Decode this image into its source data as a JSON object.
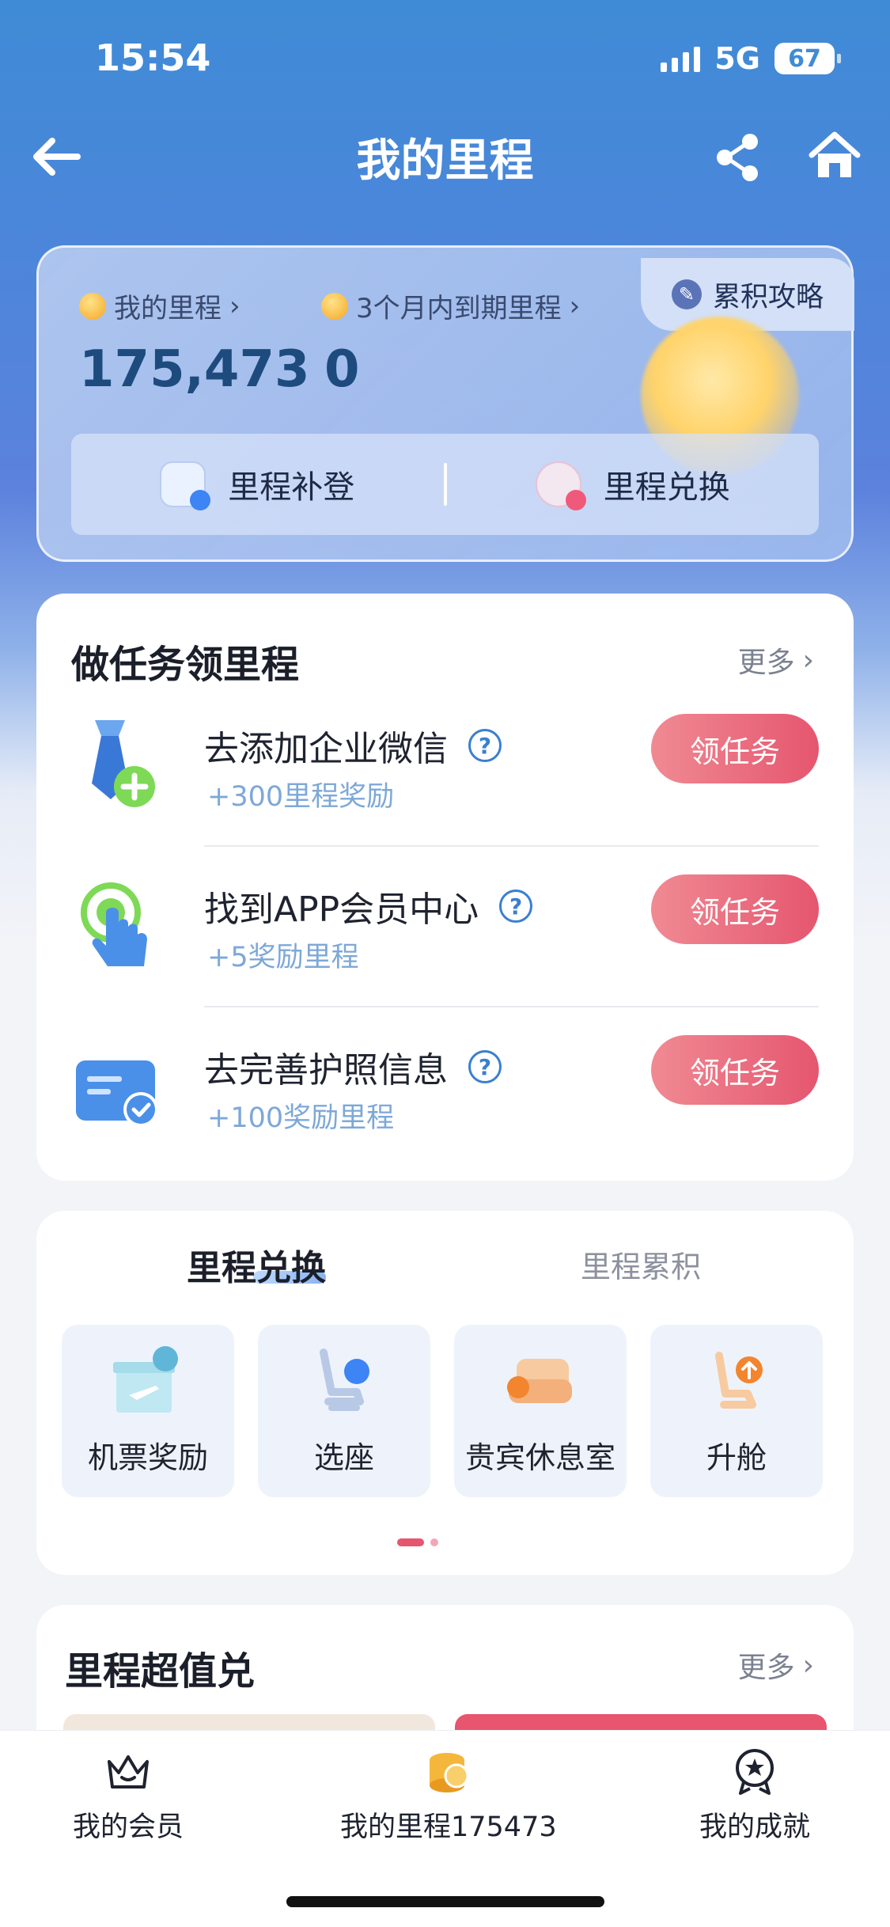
{
  "status": {
    "time": "15:54",
    "network": "5G",
    "battery": "67"
  },
  "nav": {
    "title": "我的里程",
    "back_icon": "back-arrow-icon",
    "share_icon": "share-icon",
    "home_icon": "home-icon"
  },
  "miles_card": {
    "guide_label": "累积攻略",
    "my_miles_label": "我的里程",
    "my_miles_value": "175,473",
    "expiring_label": "3个月内到期里程",
    "expiring_value": "0",
    "action_claim": "里程补登",
    "action_exchange": "里程兑换"
  },
  "tasks": {
    "title": "做任务领里程",
    "more": "更多",
    "items": [
      {
        "name": "去添加企业微信",
        "reward": "+300里程奖励",
        "button": "领任务",
        "icon": "wecom-add-icon"
      },
      {
        "name": "找到APP会员中心",
        "reward": "+5奖励里程",
        "button": "领任务",
        "icon": "tap-finger-icon"
      },
      {
        "name": "去完善护照信息",
        "reward": "+100奖励里程",
        "button": "领任务",
        "icon": "passport-card-icon"
      }
    ]
  },
  "exchange": {
    "tab_active": "里程兑换",
    "tab_other": "里程累积",
    "items": [
      {
        "label": "机票奖励",
        "icon": "ticket-gift-icon"
      },
      {
        "label": "选座",
        "icon": "seat-select-icon"
      },
      {
        "label": "贵宾休息室",
        "icon": "lounge-sofa-icon"
      },
      {
        "label": "升舱",
        "icon": "upgrade-seat-icon"
      }
    ]
  },
  "value": {
    "title": "里程超值兑",
    "more": "更多"
  },
  "tabbar": {
    "items": [
      {
        "label": "我的会员",
        "icon": "crown-icon"
      },
      {
        "label": "我的里程175473",
        "icon": "coins-icon"
      },
      {
        "label": "我的成就",
        "icon": "medal-icon"
      }
    ]
  },
  "colors": {
    "accent": "#e5566f",
    "header_blue": "#3f8bd6",
    "link_blue": "#3a7fd0"
  }
}
